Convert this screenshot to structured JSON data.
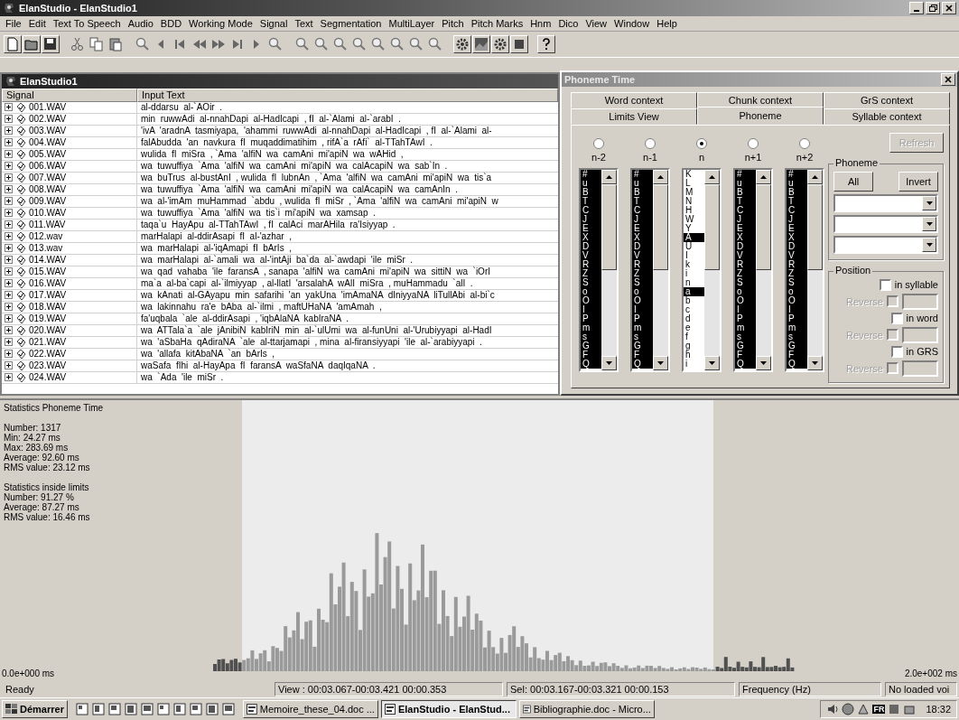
{
  "window": {
    "title": "ElanStudio - ElanStudio1"
  },
  "menu": [
    "File",
    "Edit",
    "Text To Speech",
    "Audio",
    "BDD",
    "Working Mode",
    "Signal",
    "Text",
    "Segmentation",
    "MultiLayer",
    "Pitch",
    "Pitch Marks",
    "Hnm",
    "Dico",
    "View",
    "Window",
    "Help"
  ],
  "document_window": {
    "title": "ElanStudio1",
    "columns": [
      "Signal",
      "Input Text"
    ],
    "rows": [
      {
        "signal": "001.WAV",
        "text": "al-ddarsu  al-`AOir  ."
      },
      {
        "signal": "002.WAV",
        "text": "min  ruwwAdi  al-nnahDapi  al-HadIcapi  , fI  al-`Alami  al-`arabI  ."
      },
      {
        "signal": "003.WAV",
        "text": "'ivA  'aradnA  tasmiyapa,  'ahammi  ruwwAdi  al-nnahDapi  al-HadIcapi  , fI  al-`Alami  al-"
      },
      {
        "signal": "004.WAV",
        "text": "falAbudda  'an  navkura  fI  muqaddimatihim  , rifA`a  rAfi`  al-TTahTAwI  ."
      },
      {
        "signal": "005.WAV",
        "text": "wulida  fI  miSra  , `Ama  'alfiN  wa  camAni  mi'apiN  wa  wAHid  ,"
      },
      {
        "signal": "006.WAV",
        "text": "wa  tuwuffiya  `Ama  'alfiN  wa  camAni  mi'apiN  wa  calAcapiN  wa  sab`In  ."
      },
      {
        "signal": "007.WAV",
        "text": "wa  buTrus  al-bustAnI  , wulida  fI  lubnAn  , `Ama  'alfiN  wa  camAni  mi'apiN  wa  tis`a"
      },
      {
        "signal": "008.WAV",
        "text": "wa  tuwuffiya  `Ama  'alfiN  wa  camAni  mi'apiN  wa  calAcapiN  wa  camAnIn  ."
      },
      {
        "signal": "009.WAV",
        "text": "wa  al-'imAm  muHammad  `abdu  , wulida  fI  miSr  , `Ama  'alfiN  wa  camAni  mi'apiN  w"
      },
      {
        "signal": "010.WAV",
        "text": "wa  tuwuffiya  `Ama  'alfiN  wa  tis`i  mi'apiN  wa  xamsap  ."
      },
      {
        "signal": "011.WAV",
        "text": "taqa`u  HayApu  al-TTahTAwI  , fI  calAci  marAHila  ra'Isiyyap  ."
      },
      {
        "signal": "012.wav",
        "text": "marHalapi  al-ddirAsapi  fI  al-'azhar  ,"
      },
      {
        "signal": "013.wav",
        "text": "wa  marHalapi  al-'iqAmapi  fI  bArIs  ,"
      },
      {
        "signal": "014.WAV",
        "text": "wa  marHalapi  al-`amali  wa  al-'intAji  ba`da  al-`awdapi  'ile  miSr  ."
      },
      {
        "signal": "015.WAV",
        "text": "wa  qad  vahaba  'ile  faransA  , sanapa  'alfiN  wa  camAni  mi'apiN  wa  sittiN  wa  `iOrI"
      },
      {
        "signal": "016.WAV",
        "text": "ma`a  al-ba`capi  al-`ilmiyyap  , al-llatI  'arsalahA  wAlI  miSra  , muHammadu  `alI  ."
      },
      {
        "signal": "017.WAV",
        "text": "wa  kAnati  al-GAyapu  min  safarihi  'an  yakUna  'imAmaNA  dIniyyaNA  liTullAbi  al-bi`c"
      },
      {
        "signal": "018.WAV",
        "text": "wa  lakinnahu  ra'e  bAba  al-`ilmi  , maftUHaNA  'amAmah  ,"
      },
      {
        "signal": "019.WAV",
        "text": "fa'uqbala  `ale  al-ddirAsapi  , 'iqbAlaNA  kabIraNA  ."
      },
      {
        "signal": "020.WAV",
        "text": "wa  ATTala`a  `ale  jAnibiN  kabIriN  min  al-`ulUmi  wa  al-funUni  al-'Urubiyyapi  al-HadI"
      },
      {
        "signal": "021.WAV",
        "text": "wa  'aSbaHa  qAdiraNA  `ale  al-ttarjamapi  , mina  al-firansiyyapi  'ile  al-`arabiyyapi  ."
      },
      {
        "signal": "022.WAV",
        "text": "wa  'allafa  kitAbaNA  `an  bArIs  ,"
      },
      {
        "signal": "023.WAV",
        "text": "waSafa  fIhi  al-HayApa  fI  faransA  waSfaNA  daqIqaNA  ."
      },
      {
        "signal": "024.WAV",
        "text": "wa  `Ada  'ile  miSr  ."
      }
    ]
  },
  "dialog": {
    "title": "Phoneme Time",
    "tab_rows": [
      {
        "tabs": [
          {
            "label": "Word context",
            "selected": false
          },
          {
            "label": "Chunk context",
            "selected": false
          },
          {
            "label": "GrS context",
            "selected": false
          }
        ]
      },
      {
        "tabs": [
          {
            "label": "Limits View",
            "selected": false
          },
          {
            "label": "Phoneme",
            "selected": true
          },
          {
            "label": "Syllable context",
            "selected": false
          }
        ]
      }
    ],
    "contexts": [
      {
        "label": "n-2",
        "selected": false,
        "items": [
          {
            "text": "#",
            "selected": true
          },
          {
            "text": "u",
            "selected": true
          },
          {
            "text": "B",
            "selected": true
          },
          {
            "text": "T",
            "selected": true
          },
          {
            "text": "C",
            "selected": true
          },
          {
            "text": "J",
            "selected": true
          },
          {
            "text": "E",
            "selected": true
          },
          {
            "text": "X",
            "selected": true
          },
          {
            "text": "D",
            "selected": true
          },
          {
            "text": "V",
            "selected": true
          },
          {
            "text": "R",
            "selected": true
          },
          {
            "text": "Z",
            "selected": true
          },
          {
            "text": "S",
            "selected": true
          },
          {
            "text": "o",
            "selected": true
          },
          {
            "text": "O",
            "selected": true
          },
          {
            "text": "I",
            "selected": true
          },
          {
            "text": "P",
            "selected": true
          },
          {
            "text": "m",
            "selected": true
          },
          {
            "text": "s",
            "selected": true
          },
          {
            "text": "G",
            "selected": true
          },
          {
            "text": "F",
            "selected": true
          },
          {
            "text": "Q",
            "selected": true
          }
        ]
      },
      {
        "label": "n-1",
        "selected": false,
        "items": [
          {
            "text": "#",
            "selected": true
          },
          {
            "text": "u",
            "selected": true
          },
          {
            "text": "B",
            "selected": true
          },
          {
            "text": "T",
            "selected": true
          },
          {
            "text": "C",
            "selected": true
          },
          {
            "text": "J",
            "selected": true
          },
          {
            "text": "E",
            "selected": true
          },
          {
            "text": "X",
            "selected": true
          },
          {
            "text": "D",
            "selected": true
          },
          {
            "text": "V",
            "selected": true
          },
          {
            "text": "R",
            "selected": true
          },
          {
            "text": "Z",
            "selected": true
          },
          {
            "text": "S",
            "selected": true
          },
          {
            "text": "o",
            "selected": true
          },
          {
            "text": "O",
            "selected": true
          },
          {
            "text": "I",
            "selected": true
          },
          {
            "text": "P",
            "selected": true
          },
          {
            "text": "m",
            "selected": true
          },
          {
            "text": "s",
            "selected": true
          },
          {
            "text": "G",
            "selected": true
          },
          {
            "text": "F",
            "selected": true
          },
          {
            "text": "Q",
            "selected": true
          }
        ]
      },
      {
        "label": "n",
        "selected": true,
        "items": [
          {
            "text": "K",
            "selected": false
          },
          {
            "text": "L",
            "selected": false
          },
          {
            "text": "M",
            "selected": false
          },
          {
            "text": "N",
            "selected": false
          },
          {
            "text": "H",
            "selected": false
          },
          {
            "text": "W",
            "selected": false
          },
          {
            "text": "Y",
            "selected": false
          },
          {
            "text": "A",
            "selected": true
          },
          {
            "text": "U",
            "selected": false
          },
          {
            "text": "I",
            "selected": false
          },
          {
            "text": "k",
            "selected": false
          },
          {
            "text": "i",
            "selected": false
          },
          {
            "text": "n",
            "selected": false
          },
          {
            "text": "a",
            "selected": true
          },
          {
            "text": "b",
            "selected": false
          },
          {
            "text": "c",
            "selected": false
          },
          {
            "text": "d",
            "selected": false
          },
          {
            "text": "e",
            "selected": false
          },
          {
            "text": "f",
            "selected": false
          },
          {
            "text": "g",
            "selected": false
          },
          {
            "text": "h",
            "selected": false
          },
          {
            "text": "i",
            "selected": false
          }
        ]
      },
      {
        "label": "n+1",
        "selected": false,
        "items": [
          {
            "text": "#",
            "selected": true
          },
          {
            "text": "u",
            "selected": true
          },
          {
            "text": "B",
            "selected": true
          },
          {
            "text": "T",
            "selected": true
          },
          {
            "text": "C",
            "selected": true
          },
          {
            "text": "J",
            "selected": true
          },
          {
            "text": "E",
            "selected": true
          },
          {
            "text": "X",
            "selected": true
          },
          {
            "text": "D",
            "selected": true
          },
          {
            "text": "V",
            "selected": true
          },
          {
            "text": "R",
            "selected": true
          },
          {
            "text": "Z",
            "selected": true
          },
          {
            "text": "S",
            "selected": true
          },
          {
            "text": "o",
            "selected": true
          },
          {
            "text": "O",
            "selected": true
          },
          {
            "text": "I",
            "selected": true
          },
          {
            "text": "P",
            "selected": true
          },
          {
            "text": "m",
            "selected": true
          },
          {
            "text": "s",
            "selected": true
          },
          {
            "text": "G",
            "selected": true
          },
          {
            "text": "F",
            "selected": true
          },
          {
            "text": "Q",
            "selected": true
          }
        ]
      },
      {
        "label": "n+2",
        "selected": false,
        "items": [
          {
            "text": "#",
            "selected": true
          },
          {
            "text": "u",
            "selected": true
          },
          {
            "text": "B",
            "selected": true
          },
          {
            "text": "T",
            "selected": true
          },
          {
            "text": "C",
            "selected": true
          },
          {
            "text": "J",
            "selected": true
          },
          {
            "text": "E",
            "selected": true
          },
          {
            "text": "X",
            "selected": true
          },
          {
            "text": "D",
            "selected": true
          },
          {
            "text": "V",
            "selected": true
          },
          {
            "text": "R",
            "selected": true
          },
          {
            "text": "Z",
            "selected": true
          },
          {
            "text": "S",
            "selected": true
          },
          {
            "text": "o",
            "selected": true
          },
          {
            "text": "O",
            "selected": true
          },
          {
            "text": "I",
            "selected": true
          },
          {
            "text": "P",
            "selected": true
          },
          {
            "text": "m",
            "selected": true
          },
          {
            "text": "s",
            "selected": true
          },
          {
            "text": "G",
            "selected": true
          },
          {
            "text": "F",
            "selected": true
          },
          {
            "text": "Q",
            "selected": true
          }
        ]
      }
    ],
    "refresh_button": {
      "label": "Refresh",
      "disabled": true
    },
    "phoneme_group": {
      "title": "Phoneme",
      "buttons": [
        "All",
        "Invert"
      ]
    },
    "position_group": {
      "title": "Position",
      "options": [
        {
          "label": "in syllable",
          "checked": false,
          "reverse_label": "Reverse",
          "reverse_checked": false,
          "reverse_disabled": true
        },
        {
          "label": "in word",
          "checked": false,
          "reverse_label": "Reverse",
          "reverse_checked": false,
          "reverse_disabled": true
        },
        {
          "label": "in GRS",
          "checked": false,
          "reverse_label": "Reverse",
          "reverse_checked": false,
          "reverse_disabled": true
        }
      ]
    }
  },
  "statistics": {
    "title": "Statistics Phoneme Time",
    "lines": [
      "Number: 1317",
      "Min: 24.27 ms",
      "Max: 283.69 ms",
      "Average: 92.60 ms",
      "RMS value: 23.12 ms"
    ],
    "limits_title": "Statistics inside limits",
    "limits_lines": [
      "Number: 91.27 %",
      "Average: 87.27 ms",
      "RMS value: 16.46 ms"
    ],
    "x_min_label": "0.0e+000 ms",
    "x_max_label": "2.0e+002 ms"
  },
  "status_bar": [
    "Ready",
    "View : 00:03.067-00:03.421  00:00.353",
    "Sel: 00:03.167-00:03.321  00:00.153",
    "Frequency (Hz)",
    "No loaded voi"
  ],
  "taskbar": {
    "start": "Démarrer",
    "tasks": [
      {
        "label": "Memoire_these_04.doc ...",
        "selected": false
      },
      {
        "label": "ElanStudio - ElanStud...",
        "selected": true
      },
      {
        "label": "Bibliographie.doc - Micro...",
        "selected": false
      }
    ],
    "language": "FR",
    "clock": "18:32"
  }
}
